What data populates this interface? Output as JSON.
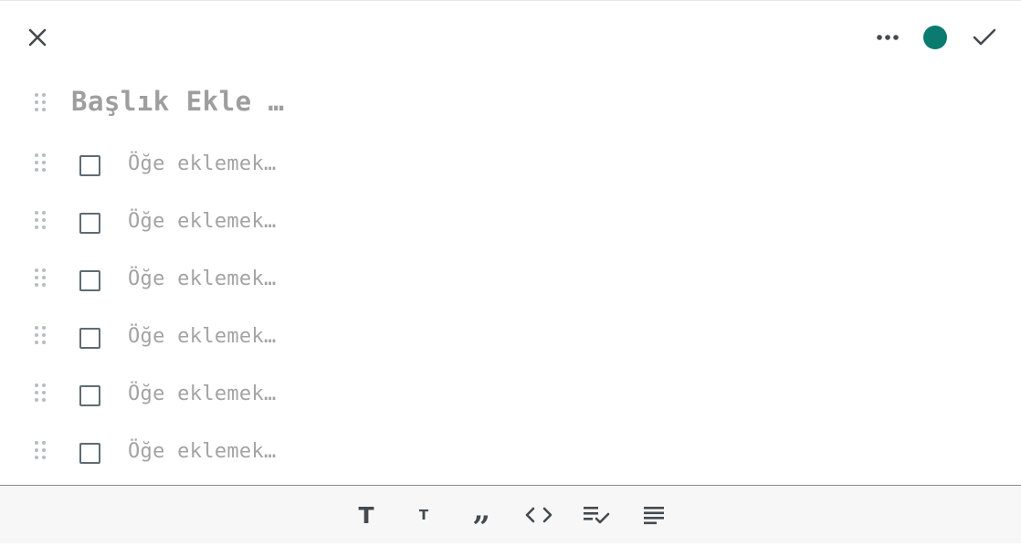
{
  "header": {
    "close_icon": "close-icon",
    "more_icon": "more-horizontal-icon",
    "note_color": "#0a7b6e",
    "confirm_icon": "check-icon"
  },
  "editor": {
    "title_placeholder": "Başlık Ekle …",
    "items": [
      {
        "placeholder": "Öğe eklemek…",
        "checked": false
      },
      {
        "placeholder": "Öğe eklemek…",
        "checked": false
      },
      {
        "placeholder": "Öğe eklemek…",
        "checked": false
      },
      {
        "placeholder": "Öğe eklemek…",
        "checked": false
      },
      {
        "placeholder": "Öğe eklemek…",
        "checked": false
      },
      {
        "placeholder": "Öğe eklemek…",
        "checked": false
      }
    ]
  },
  "toolbar": {
    "tools": [
      {
        "name": "heading-large",
        "glyph": "T",
        "icon": "heading-large-icon"
      },
      {
        "name": "heading-small",
        "glyph": "T",
        "icon": "heading-small-icon"
      },
      {
        "name": "quote",
        "glyph": "”",
        "icon": "quote-icon"
      },
      {
        "name": "code",
        "icon": "code-icon"
      },
      {
        "name": "checklist",
        "icon": "checklist-icon"
      },
      {
        "name": "paragraph",
        "icon": "paragraph-icon"
      }
    ]
  },
  "colors": {
    "text_muted": "#9e9e9e",
    "icon": "#434a50",
    "accent": "#0a7b6e"
  }
}
